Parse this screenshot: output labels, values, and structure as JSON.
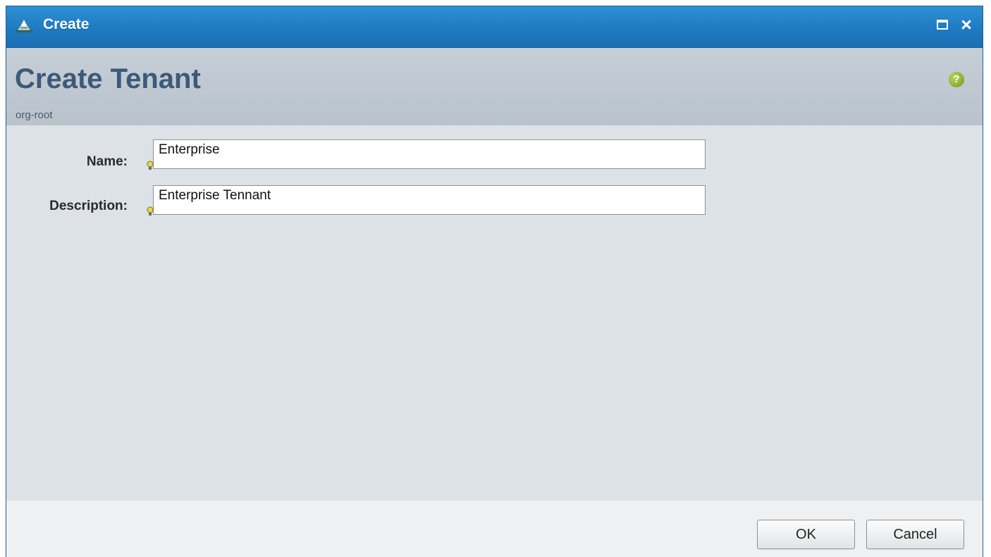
{
  "window": {
    "title": "Create",
    "title_icon": "tenant-icon",
    "maximize_icon": "maximize-icon",
    "close_icon": "close-icon",
    "close_glyph": "×"
  },
  "header": {
    "title": "Create Tenant",
    "subtitle": "org-root",
    "help_icon": "help-icon",
    "help_glyph": "?"
  },
  "form": {
    "name": {
      "label": "Name:",
      "value": "Enterprise"
    },
    "description": {
      "label": "Description:",
      "value": "Enterprise Tennant"
    }
  },
  "footer": {
    "ok_label": "OK",
    "cancel_label": "Cancel"
  },
  "colors": {
    "titlebar": "#1f7bc3",
    "header_bg": "#c0c9d1",
    "header_title": "#3c5a78",
    "help_icon": "#8fb33a"
  }
}
